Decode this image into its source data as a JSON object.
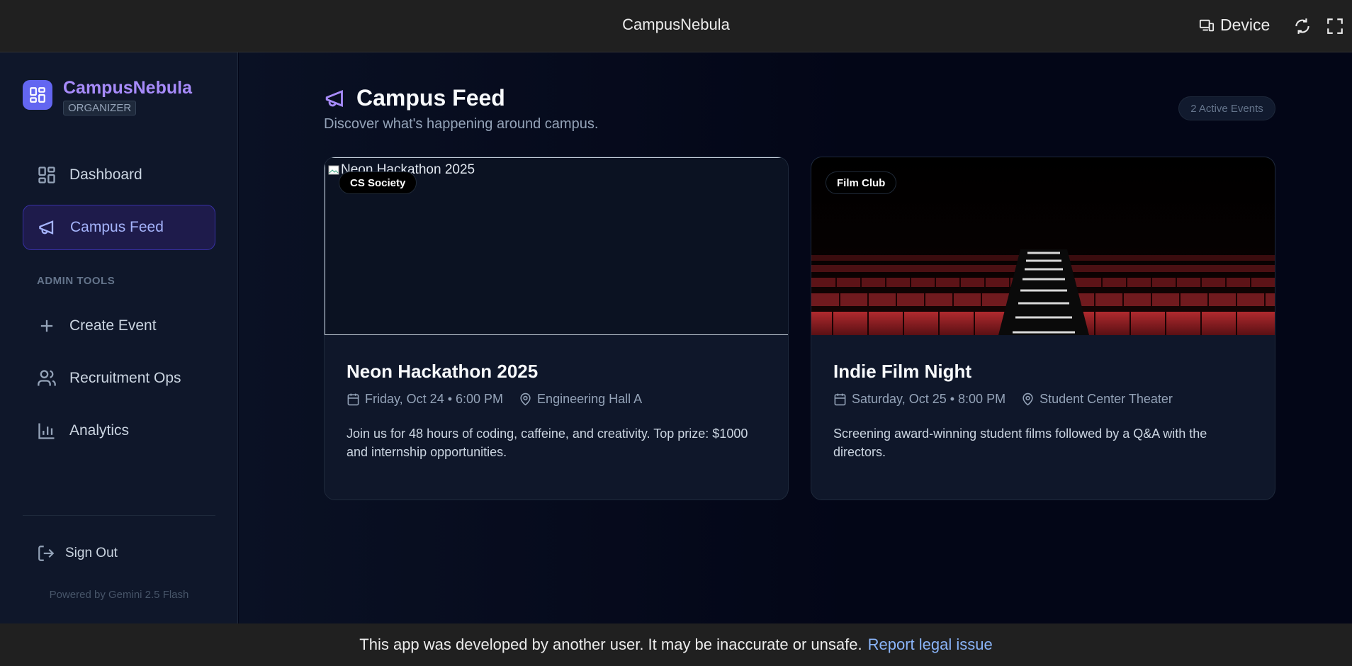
{
  "window": {
    "title": "CampusNebula",
    "device_label": "Device"
  },
  "sidebar": {
    "app_name": "CampusNebula",
    "role": "ORGANIZER",
    "items": [
      {
        "label": "Dashboard",
        "icon": "grid-icon"
      },
      {
        "label": "Campus Feed",
        "icon": "megaphone-icon",
        "active": true
      }
    ],
    "section_label": "ADMIN TOOLS",
    "admin_items": [
      {
        "label": "Create Event",
        "icon": "plus-icon"
      },
      {
        "label": "Recruitment Ops",
        "icon": "users-icon"
      },
      {
        "label": "Analytics",
        "icon": "bar-chart-icon"
      }
    ],
    "sign_out": "Sign Out",
    "powered_by": "Powered by Gemini 2.5 Flash"
  },
  "main": {
    "title": "Campus Feed",
    "subtitle": "Discover what's happening around campus.",
    "badge": "2 Active Events",
    "events": [
      {
        "tag": "CS Society",
        "image_alt": "Neon Hackathon 2025",
        "title": "Neon Hackathon 2025",
        "date": "Friday, Oct 24 • 6:00 PM",
        "location": "Engineering Hall A",
        "description": "Join us for 48 hours of coding, caffeine, and creativity. Top prize: $1000 and internship opportunities."
      },
      {
        "tag": "Film Club",
        "title": "Indie Film Night",
        "date": "Saturday, Oct 25 • 8:00 PM",
        "location": "Student Center Theater",
        "description": "Screening award-winning student films followed by a Q&A with the directors."
      }
    ]
  },
  "footer": {
    "notice": "This app was developed by another user. It may be inaccurate or unsafe.",
    "link": "Report legal issue"
  },
  "colors": {
    "accent": "#a78bfa",
    "brand": "#6366f1",
    "active_bg": "#1e1b4b",
    "background": "#030617"
  }
}
